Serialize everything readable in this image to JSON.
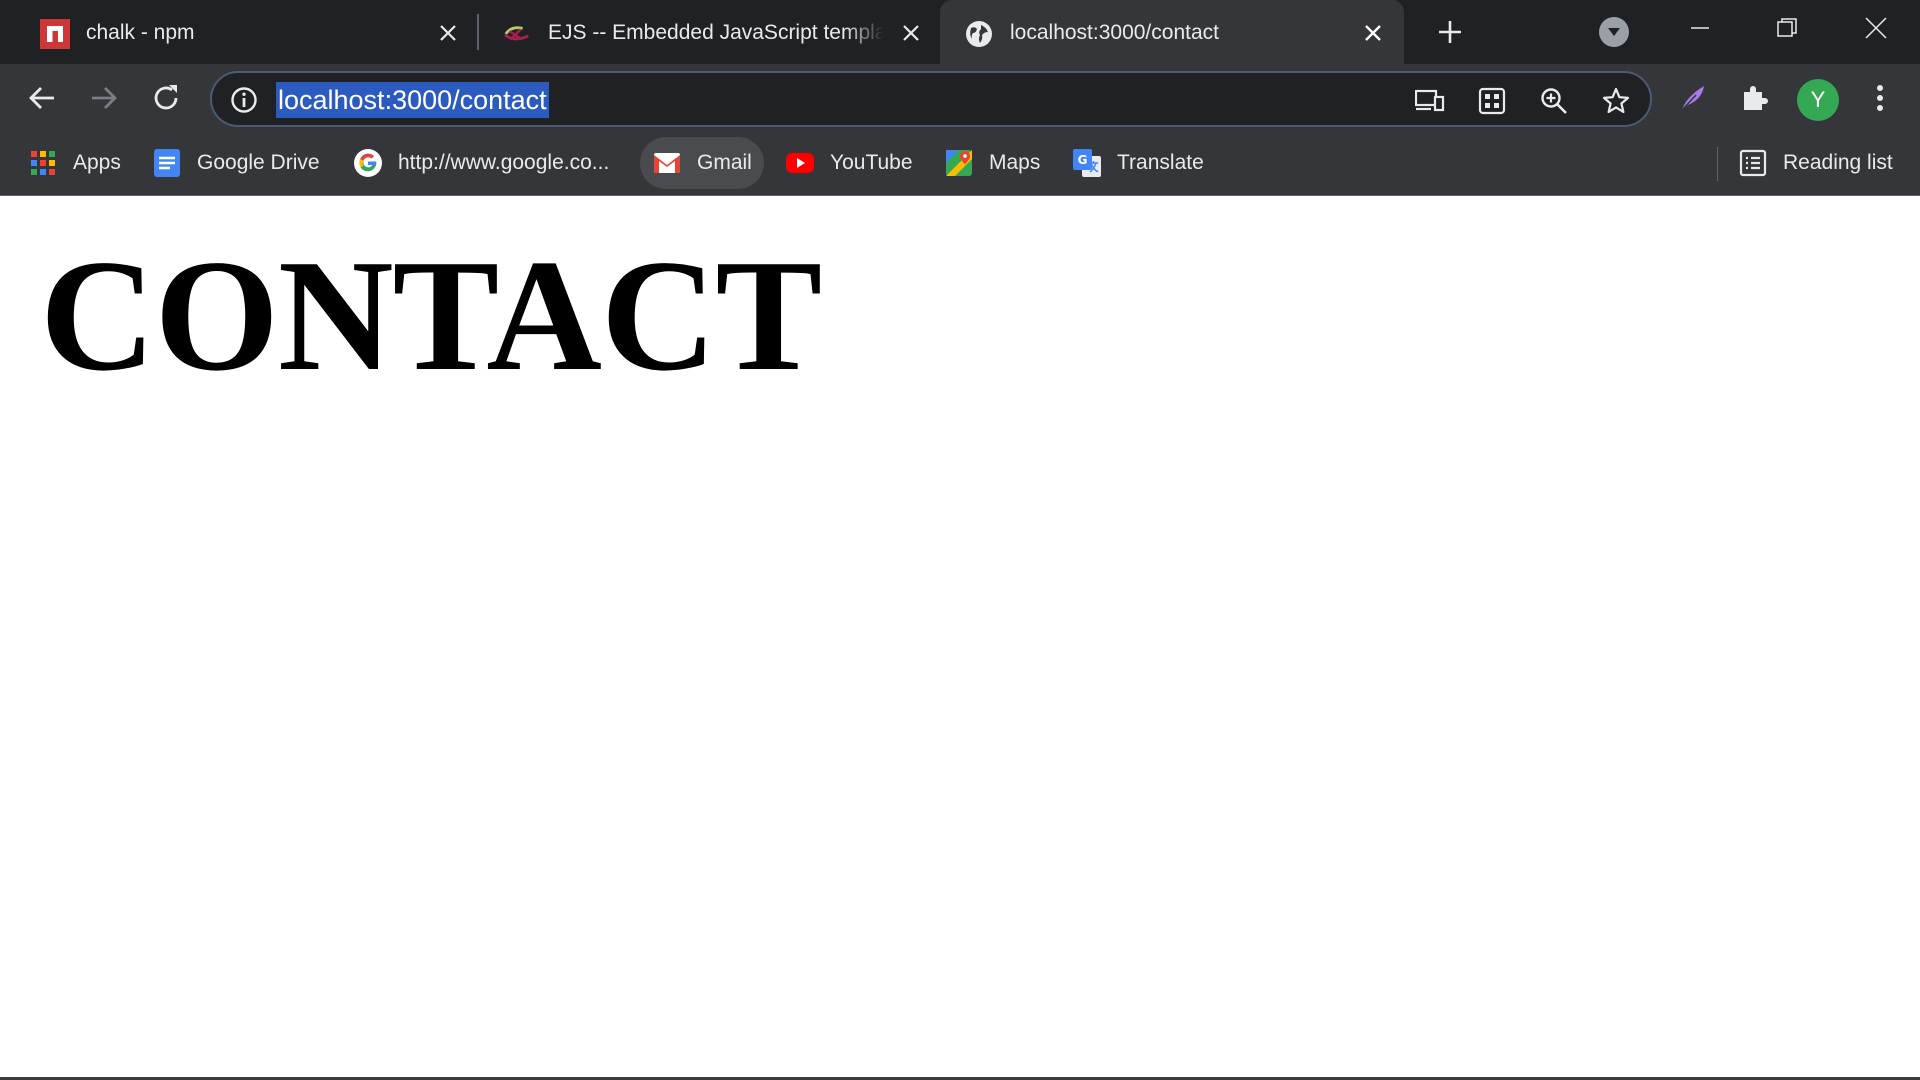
{
  "tabs": [
    {
      "title": "chalk - npm",
      "favicon": "npm-icon",
      "active": false
    },
    {
      "title": "EJS -- Embedded JavaScript templat",
      "favicon": "ejs-icon",
      "active": false
    },
    {
      "title": "localhost:3000/contact",
      "favicon": "globe-icon",
      "active": true
    }
  ],
  "address_bar": {
    "url": "localhost:3000/contact"
  },
  "profile": {
    "initial": "Y",
    "color": "#34a853"
  },
  "bookmarks": [
    {
      "label": "Apps",
      "icon": "apps-grid-icon"
    },
    {
      "label": "Google Drive",
      "icon": "google-docs-icon"
    },
    {
      "label": "http://www.google.co...",
      "icon": "google-g-icon"
    },
    {
      "label": "Gmail",
      "icon": "gmail-icon"
    },
    {
      "label": "YouTube",
      "icon": "youtube-icon"
    },
    {
      "label": "Maps",
      "icon": "maps-icon"
    },
    {
      "label": "Translate",
      "icon": "translate-icon"
    }
  ],
  "reading_list": {
    "label": "Reading list",
    "icon": "reading-list-icon"
  },
  "page": {
    "heading": "CONTACT"
  },
  "colors": {
    "tabstrip": "#202124",
    "toolbar": "#35363a",
    "url_highlight": "#2c5bbf",
    "text": "#e8eaed"
  }
}
